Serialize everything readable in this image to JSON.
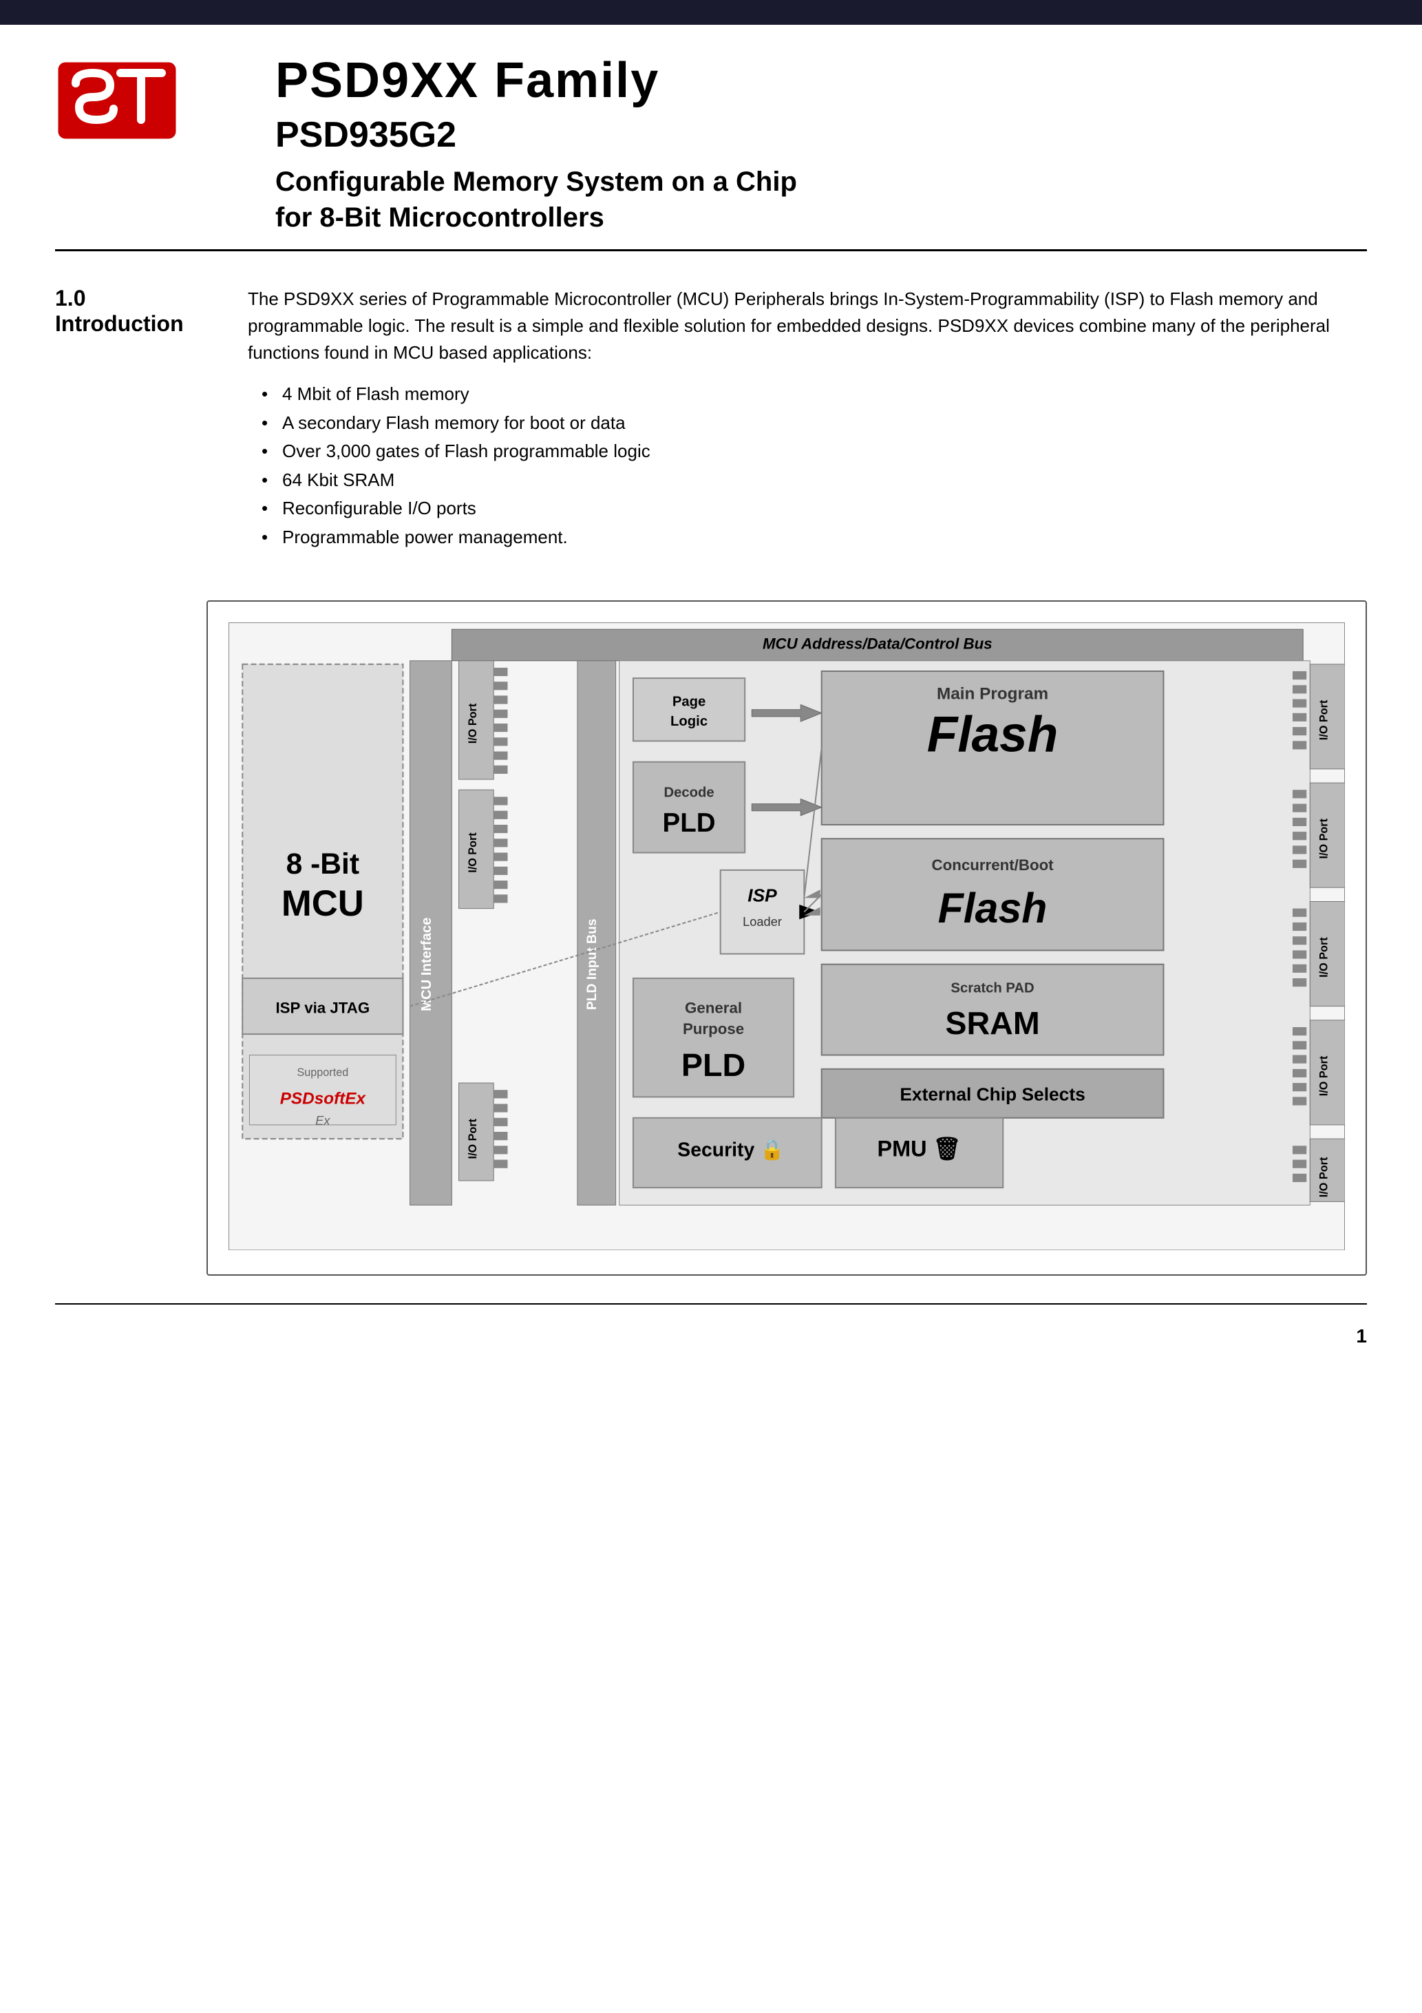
{
  "header": {
    "bar_color": "#1a1a2e"
  },
  "title": {
    "main": "PSD9XX Family",
    "sub": "PSD935G2",
    "desc_line1": "Configurable Memory System on a Chip",
    "desc_line2": "for 8-Bit Microcontrollers"
  },
  "section": {
    "number": "1.0",
    "name": "Introduction",
    "body_para": "The PSD9XX series of Programmable Microcontroller (MCU) Peripherals brings In-System-Programmability (ISP) to Flash memory and programmable logic. The result is a simple and flexible solution for embedded designs. PSD9XX devices combine many of the peripheral functions found in MCU based applications:",
    "bullets": [
      "4 Mbit of Flash memory",
      "A secondary Flash memory for boot or data",
      "Over 3,000 gates of Flash programmable logic",
      "64 Kbit SRAM",
      "Reconfigurable I/O ports",
      "Programmable power management."
    ]
  },
  "diagram": {
    "bus_label": "MCU Address/Data/Control Bus",
    "mcu_label": "8 -Bit\nMCU",
    "mcu_interface_label": "MCU Interface",
    "isp_jtag_label": "ISP via JTAG",
    "isp_label": "ISP\nLoader",
    "page_logic_label": "Page\nLogic",
    "decode_label": "Decode",
    "pld_decode_label": "PLD",
    "main_program_label": "Main Program",
    "main_flash_label": "Flash",
    "concurrent_boot_label": "Concurrent/Boot",
    "concurrent_flash_label": "Flash",
    "scratch_pad_label": "Scratch PAD",
    "sram_label": "SRAM",
    "general_purpose_label": "General\nPurpose",
    "pld_gp_label": "PLD",
    "external_chip_selects_label": "External Chip Selects",
    "security_label": "Security",
    "pmu_label": "PMU",
    "pld_input_bus_label": "PLD Input Bus",
    "io_port_labels": [
      "I/O Port",
      "I/O Port",
      "I/O Port",
      "I/O Port",
      "I/O Port",
      "I/O Port",
      "I/O Port",
      "I/O Port"
    ],
    "supported_label": "Supported",
    "psdsoft_label": "PSDsoftEx"
  },
  "footer": {
    "page_number": "1"
  }
}
